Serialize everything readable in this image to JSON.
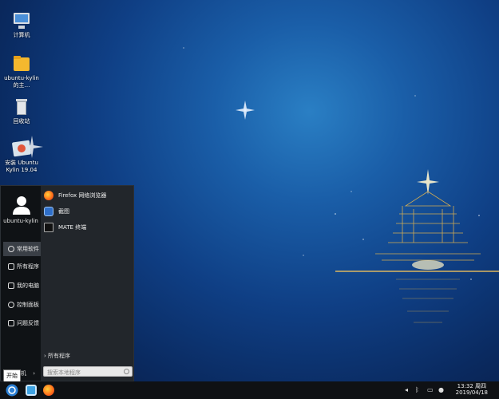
{
  "desktop": {
    "icons": [
      {
        "label": "计算机",
        "icon": "computer-icon"
      },
      {
        "label": "ubuntu-kylin 的主…",
        "icon": "folder-icon"
      },
      {
        "label": "回收站",
        "icon": "trash-icon"
      },
      {
        "label": "安装 Ubuntu Kylin 19.04",
        "icon": "installer-icon"
      }
    ]
  },
  "start_menu": {
    "username": "ubuntu-kylin",
    "categories": [
      "常用软件",
      "所有程序",
      "我的电脑",
      "控制面板",
      "问题反馈"
    ],
    "apps": [
      {
        "label": "Firefox 网络浏览器",
        "icon": "firefox-icon"
      },
      {
        "label": "截图",
        "icon": "screenshot-icon"
      },
      {
        "label": "MATE 终端",
        "icon": "terminal-icon"
      }
    ],
    "all_programs": "所有程序",
    "search_placeholder": "搜索本地程序",
    "power_label": "机"
  },
  "taskbar": {
    "start_tooltip": "开始",
    "clock_time": "13:32 周四",
    "clock_date": "2019/04/18"
  },
  "colors": {
    "accent": "#2b7fd4",
    "menu_bg": "#16191d",
    "taskbar_bg": "#0f1114"
  }
}
